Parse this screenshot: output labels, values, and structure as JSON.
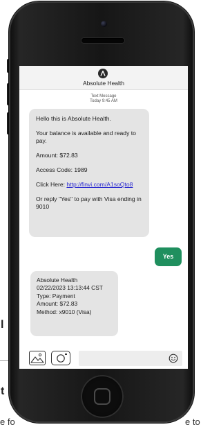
{
  "app": {
    "title": "Absolute Health"
  },
  "conversation": {
    "meta_line1": "Text Message",
    "meta_line2": "Today 9:45 AM",
    "incoming_1": {
      "greeting": "Hello this is Absolute Health.",
      "balance_text": "Your balance is available and ready to pay.",
      "amount": "Amount: $72.83",
      "access_code": "Access Code: 1989",
      "click_prefix": "Click Here: ",
      "link_text": "http://finvi.com/A1soQto8",
      "reply_text": "Or reply \"Yes\" to pay with Visa ending in 9010"
    },
    "outgoing_1": {
      "text": "Yes"
    },
    "incoming_2": {
      "line1": "Absolute Health",
      "line2": "02/22/2023 13:13:44 CST",
      "line3": "Type: Payment",
      "line4": "Amount: $72.83",
      "line5": "Method: x9010 (Visa)"
    }
  },
  "composer": {
    "gallery_icon": "image-gallery-icon",
    "camera_icon": "camera-icon",
    "emoji_icon": "emoji-smiley-icon",
    "placeholder": ""
  },
  "background_page": {
    "left_fragment_1": "l",
    "left_fragment_2": "t",
    "bottom_left_fragment": "e fo",
    "bottom_right_fragment": "e to"
  },
  "colors": {
    "accent_green": "#1f8f5e",
    "incoming_bubble": "#e4e4e4",
    "link_blue": "#2a2ad0",
    "phone_body": "#161616"
  }
}
